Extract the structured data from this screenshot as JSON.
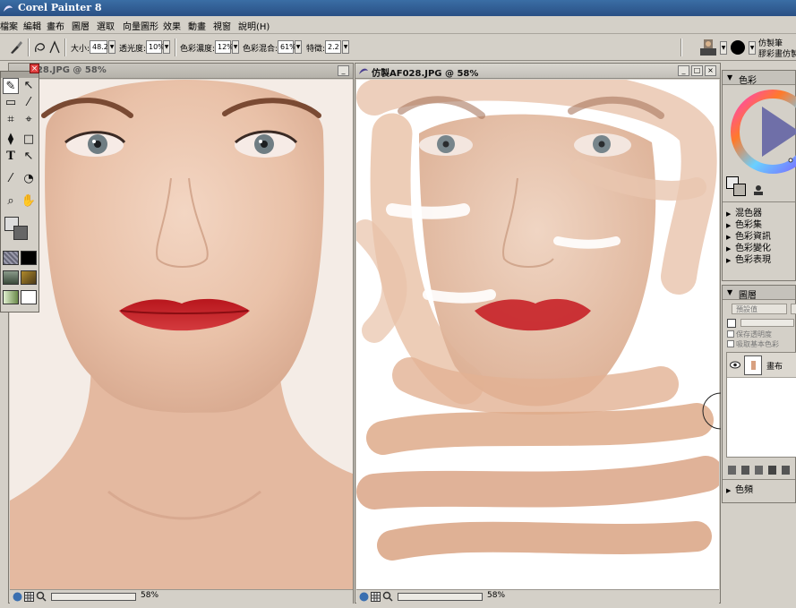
{
  "app": {
    "title": "Corel Painter 8"
  },
  "menu": [
    "檔案",
    "編輯",
    "畫布",
    "圖層",
    "選取",
    "向量圖形",
    "效果",
    "動畫",
    "視窗",
    "說明(H)"
  ],
  "property_bar": {
    "size_label": "大小:",
    "size_value": "48.2",
    "opacity_label": "透光度:",
    "opacity_value": "10%",
    "resat_label": "色彩濃度:",
    "resat_value": "12%",
    "bleed_label": "色彩混合:",
    "bleed_value": "61%",
    "feature_label": "特徵:",
    "feature_value": "2.2",
    "brush_category": "仿製筆",
    "brush_variant": "膠彩畫仿製"
  },
  "doc_left": {
    "title": "028.JPG @ 58%",
    "zoom": "58%"
  },
  "doc_right": {
    "title": "仿製AF028.JPG @ 58%",
    "zoom": "58%"
  },
  "toolbox": {
    "tools": [
      "brush-tool-icon",
      "layer-adjuster-icon",
      "rect-select-icon",
      "magic-wand-icon",
      "crop-icon",
      "lasso-icon",
      "paint-bucket-icon",
      "shape-icon",
      "text-icon",
      "selection-adjuster-icon",
      "dropper-icon",
      "cloner-icon",
      "magnifier-icon",
      "grabber-icon"
    ]
  },
  "color_panel": {
    "title": "色彩"
  },
  "panel_list": [
    "混色器",
    "色彩集",
    "色彩資訊",
    "色彩變化",
    "色彩表現"
  ],
  "layers_panel": {
    "title": "圖層",
    "composite_method": "預設值",
    "preserve_transparency": "保存透明度",
    "pick_up_color": "吸取基本色彩",
    "layer_name": "畫布"
  },
  "bottom_panel": {
    "title": "色頻"
  },
  "colors": {
    "titlebar": "#2a4f84",
    "panel": "#d4d0c8",
    "lip": "#c8252a"
  }
}
